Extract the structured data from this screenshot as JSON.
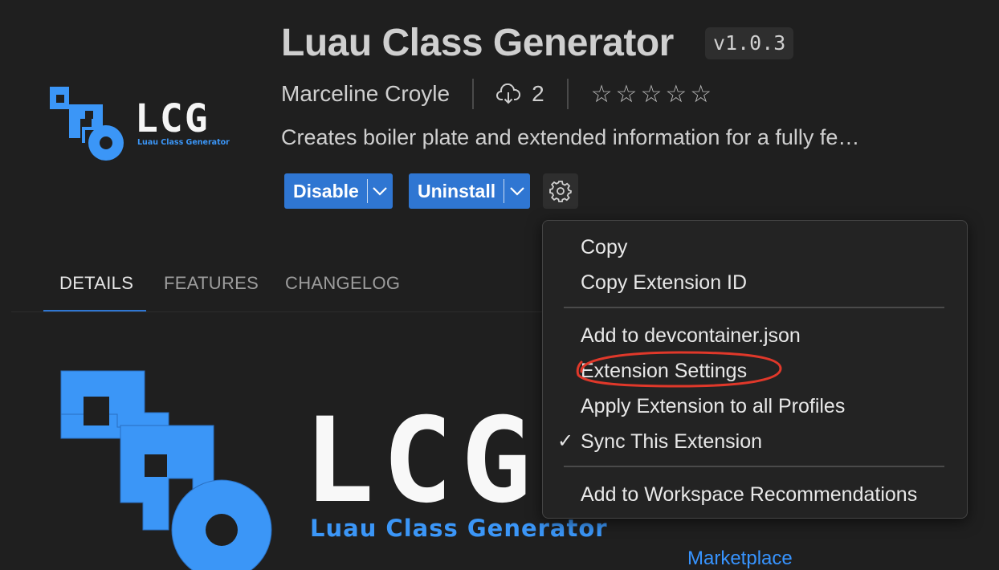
{
  "extension": {
    "title": "Luau Class Generator",
    "version": "v1.0.3",
    "publisher": "Marceline Croyle",
    "install_count": "2",
    "rating_stars": "☆☆☆☆☆",
    "description": "Creates boiler plate and extended information for a fully fe…"
  },
  "logo": {
    "wordmark": "LCG",
    "tagline": "Luau Class Generator",
    "accent_color": "#3b96f7"
  },
  "actions": {
    "disable_label": "Disable",
    "uninstall_label": "Uninstall",
    "button_color": "#2f76d2"
  },
  "tabs": [
    {
      "label": "DETAILS",
      "active": true
    },
    {
      "label": "FEATURES",
      "active": false
    },
    {
      "label": "CHANGELOG",
      "active": false
    }
  ],
  "context_menu": {
    "items": [
      {
        "label": "Copy"
      },
      {
        "label": "Copy Extension ID"
      },
      {
        "label": "Add to devcontainer.json"
      },
      {
        "label": "Extension Settings",
        "annotation": "circled"
      },
      {
        "label": "Apply Extension to all Profiles"
      },
      {
        "label": "Sync This Extension",
        "checked": true
      },
      {
        "label": "Add to Workspace Recommendations"
      }
    ],
    "check_glyph": "✓",
    "annotation_color": "#e0382a"
  },
  "sidebar_link": "Marketplace"
}
